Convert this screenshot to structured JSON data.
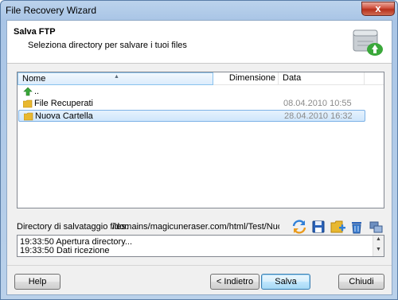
{
  "window": {
    "title": "File Recovery Wizard",
    "close_glyph": "x"
  },
  "header": {
    "title": "Salva FTP",
    "subtitle": "Seleziona directory per salvare i tuoi files",
    "icon": "ftp-server-icon"
  },
  "list": {
    "columns": {
      "name": "Nome",
      "size": "Dimensione",
      "date": "Data"
    },
    "rows": [
      {
        "name": "..",
        "date": "",
        "icon": "up-arrow-icon"
      },
      {
        "name": "File Recuperati",
        "date": "08.04.2010 10:55",
        "icon": "folder-icon"
      },
      {
        "name": "Nuova Cartella",
        "date": "28.04.2010 16:32",
        "icon": "folder-icon",
        "selected": true
      }
    ]
  },
  "directory": {
    "label": "Directory di salvataggio files:",
    "path": "/domains/magicuneraser.com/html/Test/Nuova Carte"
  },
  "toolbar": [
    "refresh-icon",
    "save-icon",
    "new-folder-icon",
    "delete-icon",
    "connection-icon"
  ],
  "log": {
    "lines": [
      "19:33:50 Apertura directory...",
      "19:33:50 Dati ricezione"
    ]
  },
  "buttons": {
    "help": "Help",
    "back": "< Indietro",
    "save": "Salva",
    "close": "Chiudi"
  },
  "colors": {
    "folder": "#e8b830",
    "accent_green": "#3aa83a",
    "selection": "#cfe6fc"
  }
}
